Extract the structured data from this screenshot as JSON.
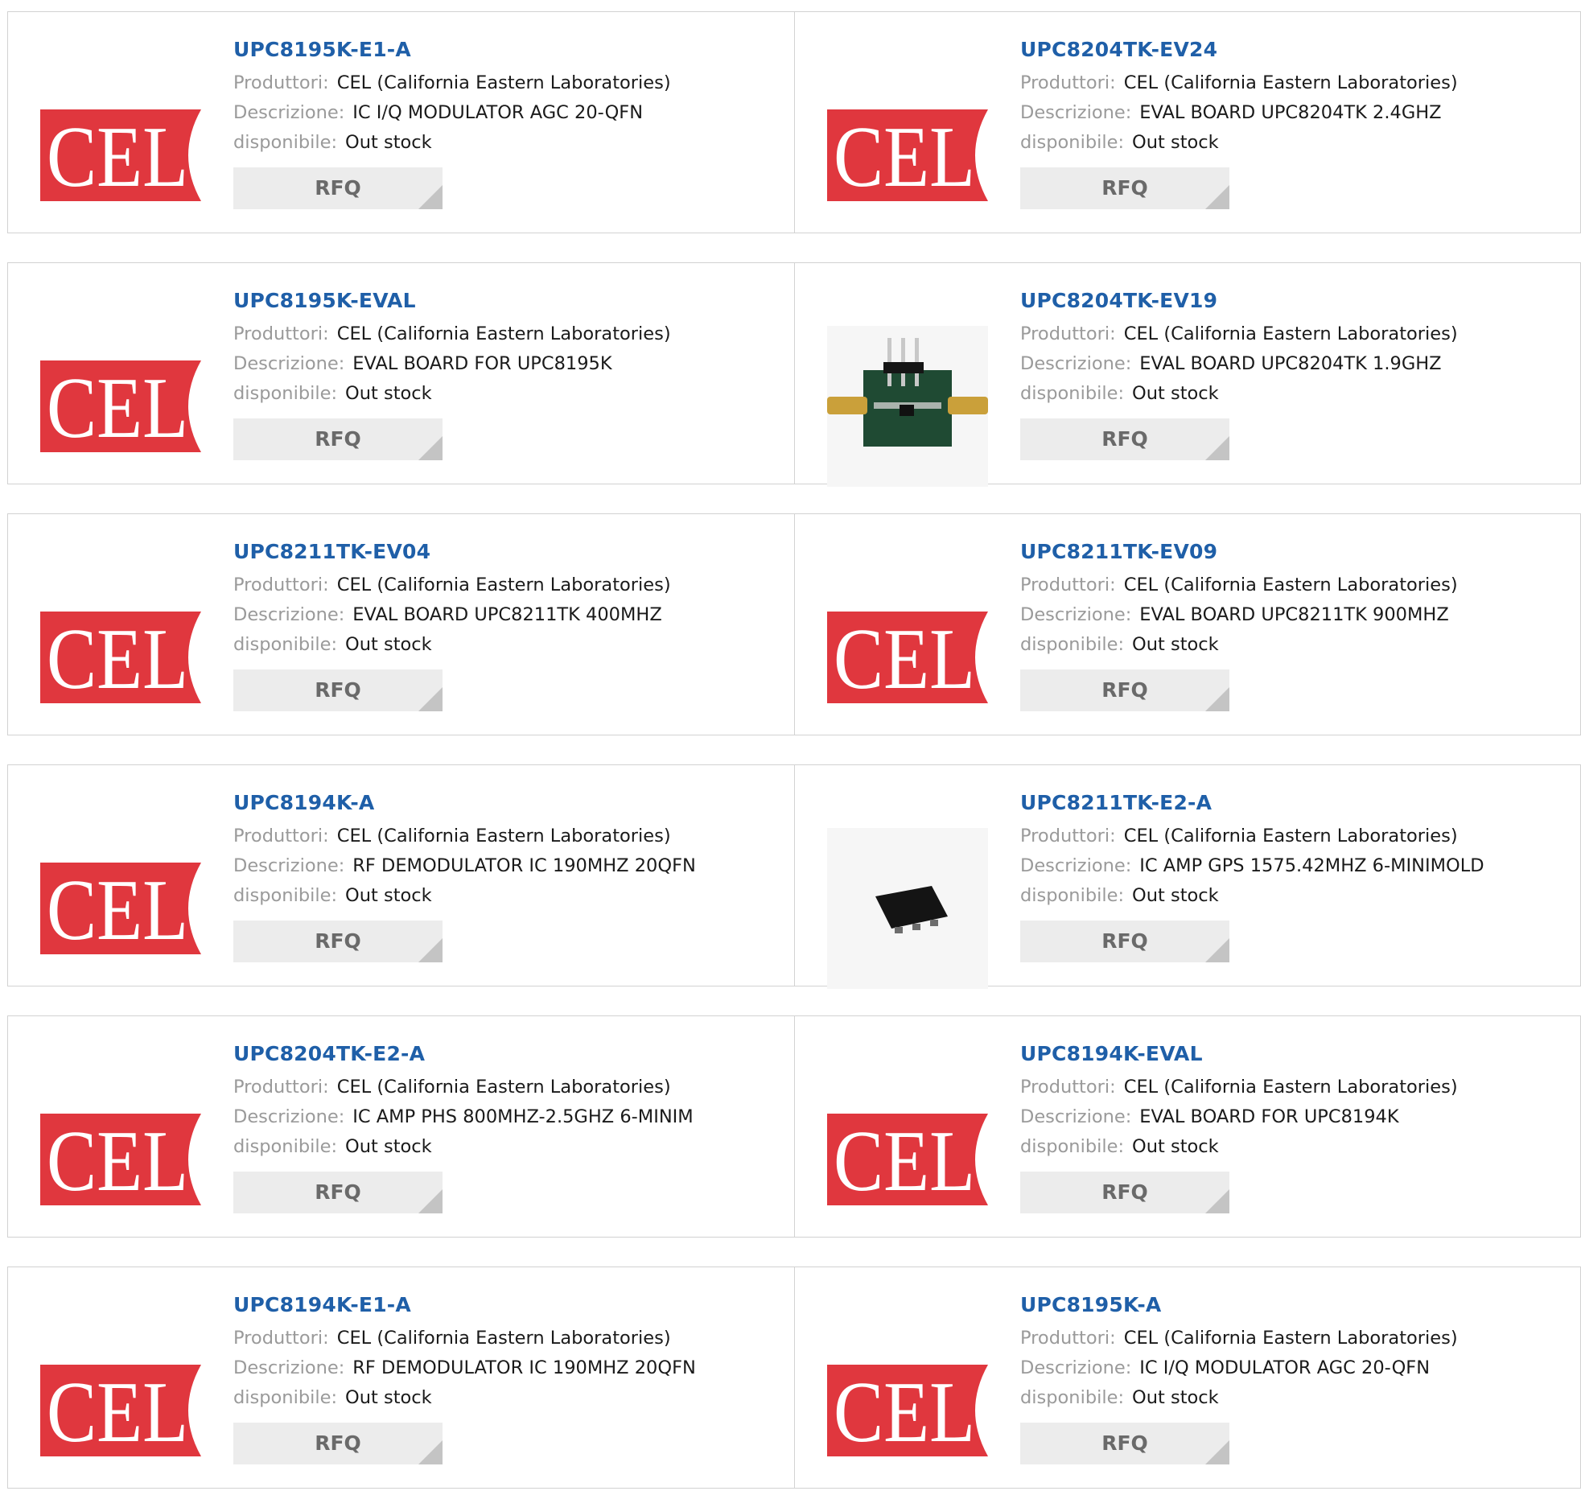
{
  "labels": {
    "manufacturer": "Produttori:",
    "description": "Descrizione:",
    "availability": "disponibile:",
    "rfq": "RFQ"
  },
  "logo_text": "CEL",
  "colors": {
    "title": "#1f5fa8",
    "logo_red": "#e0373e",
    "rfq_bg": "#ececec"
  },
  "products": [
    {
      "part": "UPC8195K-E1-A",
      "manufacturer": "CEL (California Eastern Laboratories)",
      "description": "IC I/Q MODULATOR AGC 20-QFN",
      "availability": "Out stock",
      "image": "cel-logo"
    },
    {
      "part": "UPC8204TK-EV24",
      "manufacturer": "CEL (California Eastern Laboratories)",
      "description": "EVAL BOARD UPC8204TK 2.4GHZ",
      "availability": "Out stock",
      "image": "cel-logo"
    },
    {
      "part": "UPC8195K-EVAL",
      "manufacturer": "CEL (California Eastern Laboratories)",
      "description": "EVAL BOARD FOR UPC8195K",
      "availability": "Out stock",
      "image": "cel-logo"
    },
    {
      "part": "UPC8204TK-EV19",
      "manufacturer": "CEL (California Eastern Laboratories)",
      "description": "EVAL BOARD UPC8204TK 1.9GHZ",
      "availability": "Out stock",
      "image": "eval-board-photo"
    },
    {
      "part": "UPC8211TK-EV04",
      "manufacturer": "CEL (California Eastern Laboratories)",
      "description": "EVAL BOARD UPC8211TK 400MHZ",
      "availability": "Out stock",
      "image": "cel-logo"
    },
    {
      "part": "UPC8211TK-EV09",
      "manufacturer": "CEL (California Eastern Laboratories)",
      "description": "EVAL BOARD UPC8211TK 900MHZ",
      "availability": "Out stock",
      "image": "cel-logo"
    },
    {
      "part": "UPC8194K-A",
      "manufacturer": "CEL (California Eastern Laboratories)",
      "description": "RF DEMODULATOR IC 190MHZ 20QFN",
      "availability": "Out stock",
      "image": "cel-logo"
    },
    {
      "part": "UPC8211TK-E2-A",
      "manufacturer": "CEL (California Eastern Laboratories)",
      "description": "IC AMP GPS 1575.42MHZ 6-MINIMOLD",
      "availability": "Out stock",
      "image": "ic-package-photo"
    },
    {
      "part": "UPC8204TK-E2-A",
      "manufacturer": "CEL (California Eastern Laboratories)",
      "description": "IC AMP PHS 800MHZ-2.5GHZ 6-MINIM",
      "availability": "Out stock",
      "image": "cel-logo"
    },
    {
      "part": "UPC8194K-EVAL",
      "manufacturer": "CEL (California Eastern Laboratories)",
      "description": "EVAL BOARD FOR UPC8194K",
      "availability": "Out stock",
      "image": "cel-logo"
    },
    {
      "part": "UPC8194K-E1-A",
      "manufacturer": "CEL (California Eastern Laboratories)",
      "description": "RF DEMODULATOR IC 190MHZ 20QFN",
      "availability": "Out stock",
      "image": "cel-logo"
    },
    {
      "part": "UPC8195K-A",
      "manufacturer": "CEL (California Eastern Laboratories)",
      "description": "IC I/Q MODULATOR AGC 20-QFN",
      "availability": "Out stock",
      "image": "cel-logo"
    }
  ]
}
